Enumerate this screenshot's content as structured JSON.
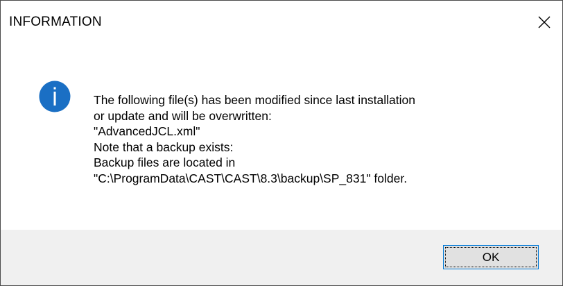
{
  "window": {
    "title": "INFORMATION",
    "close_icon": "close-icon"
  },
  "message": {
    "icon": "info-icon",
    "lines": [
      "The following file(s) has been modified since last installation",
      "or update and will be overwritten:",
      "\"AdvancedJCL.xml\"",
      "Note that a backup exists:",
      "Backup files are located in",
      "\"C:\\ProgramData\\CAST\\CAST\\8.3\\backup\\SP_831\" folder."
    ]
  },
  "buttons": {
    "ok_label": "OK"
  },
  "colors": {
    "info_icon": "#1a6fc4",
    "button_border": "#0078d7",
    "footer_background": "#f0f0f0"
  }
}
